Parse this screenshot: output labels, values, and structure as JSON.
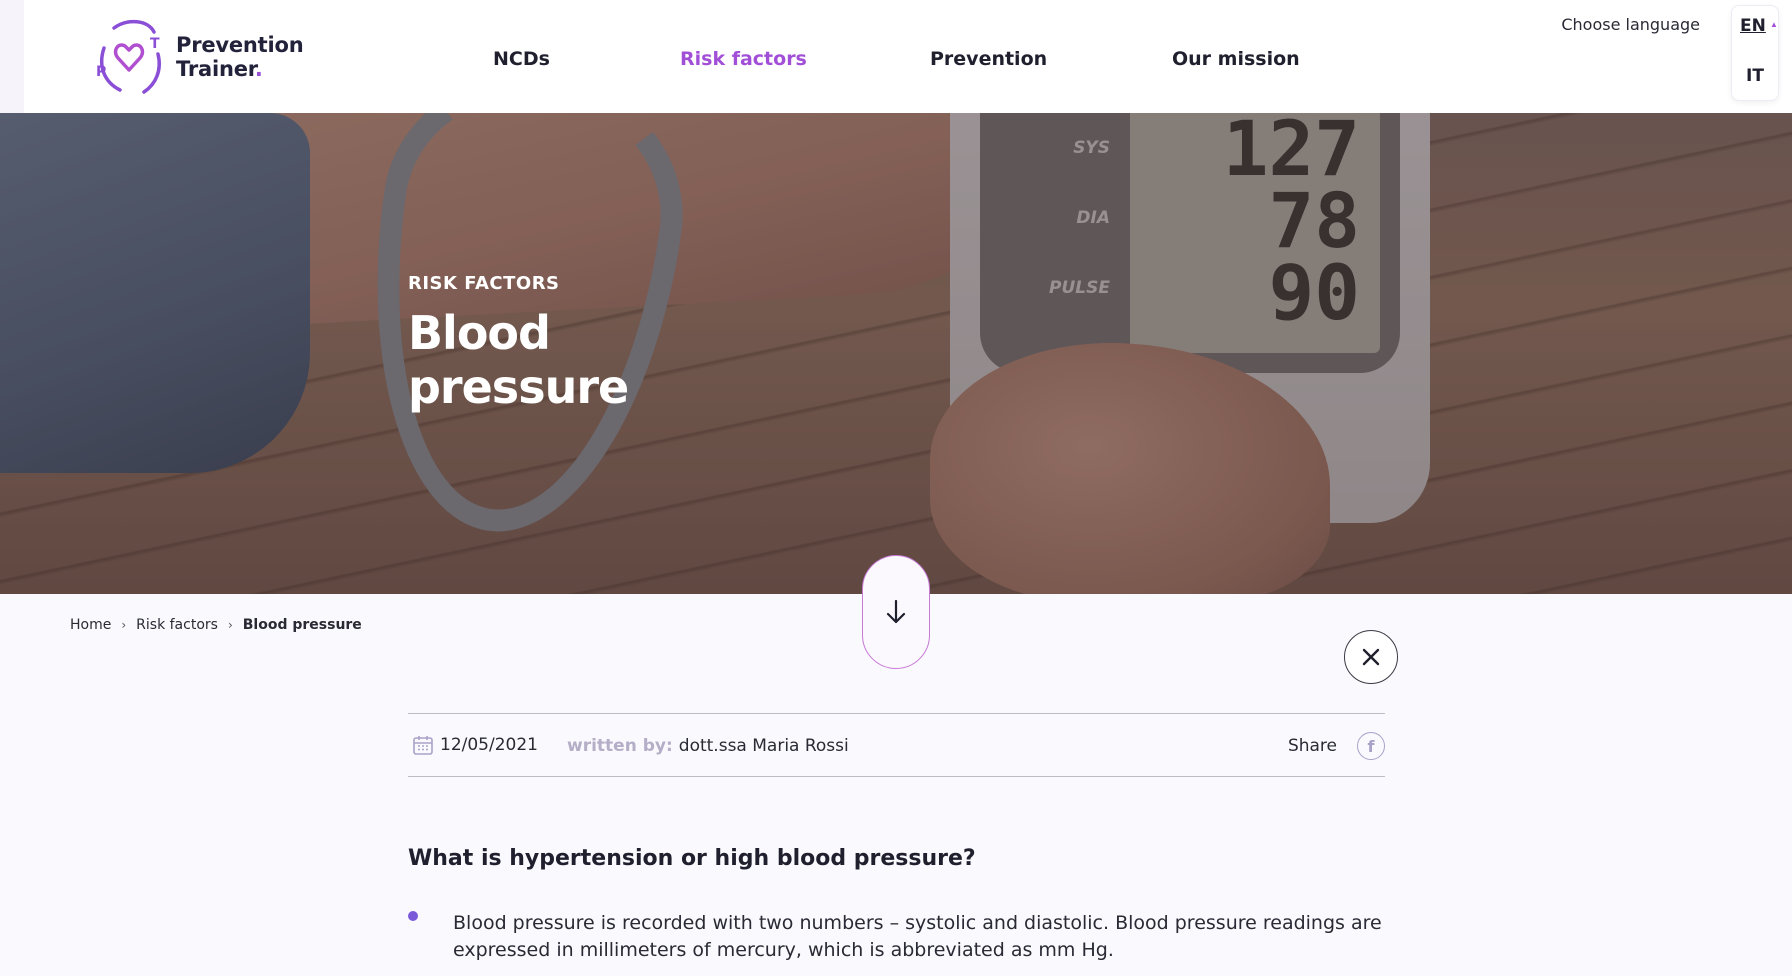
{
  "brand": {
    "line1": "Prevention",
    "line2": "Trainer",
    "dot": "."
  },
  "nav": [
    {
      "label": "NCDs",
      "active": false
    },
    {
      "label": "Risk factors",
      "active": true
    },
    {
      "label": "Prevention",
      "active": false
    },
    {
      "label": "Our mission",
      "active": false
    }
  ],
  "language": {
    "label": "Choose language",
    "current": "EN",
    "other": "IT"
  },
  "hero": {
    "kicker": "RISK FACTORS",
    "title": "Blood pressure",
    "device": {
      "sys_label": "SYS",
      "dia_label": "DIA",
      "pulse_label": "PULSE",
      "sys": "127",
      "dia": "78",
      "pulse": "90"
    }
  },
  "breadcrumb": {
    "home": "Home",
    "section": "Risk factors",
    "current": "Blood pressure"
  },
  "meta": {
    "date": "12/05/2021",
    "author_label": "written by:",
    "author": "dott.ssa Maria Rossi",
    "share_label": "Share",
    "share_icon": "facebook-icon"
  },
  "article": {
    "section_title": "What is hypertension or high blood pressure?",
    "bullets": [
      "Blood pressure is recorded with two numbers – systolic and diastolic. Blood pressure readings are expressed in millimeters of mercury, which is abbreviated as mm Hg."
    ]
  },
  "colors": {
    "accent": "#a24fd8",
    "bullet": "#7a5ad8",
    "text": "#2a2a35"
  }
}
